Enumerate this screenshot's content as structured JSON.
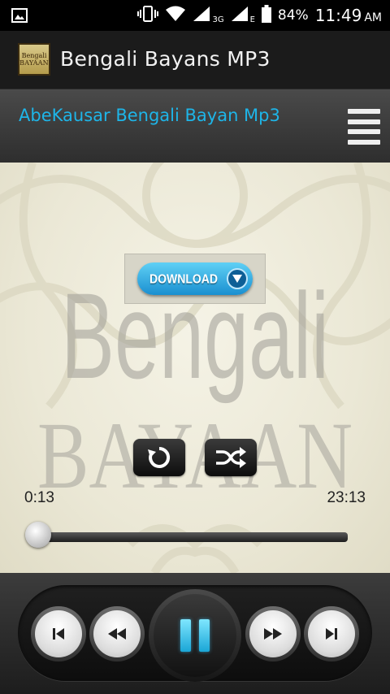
{
  "status_bar": {
    "network_small": "3G",
    "network_small2": "E",
    "battery": "84%",
    "time": "11:49",
    "ampm": "AM"
  },
  "action_bar": {
    "logo_line1": "Bengali",
    "logo_line2": "BAYAAN",
    "title": "Bengali Bayans MP3"
  },
  "header": {
    "track_title": "AbeKausar Bengali Bayan Mp3"
  },
  "content": {
    "watermark_line1": "Bengali",
    "watermark_line2": "BAYAAN",
    "download_label": "DOWNLOAD"
  },
  "player": {
    "elapsed": "0:13",
    "total": "23:13",
    "progress_fraction": 0.009
  },
  "colors": {
    "accent": "#1eb5e8",
    "header_bg": "#3a3a3a",
    "content_bg": "#ebe8d6"
  }
}
